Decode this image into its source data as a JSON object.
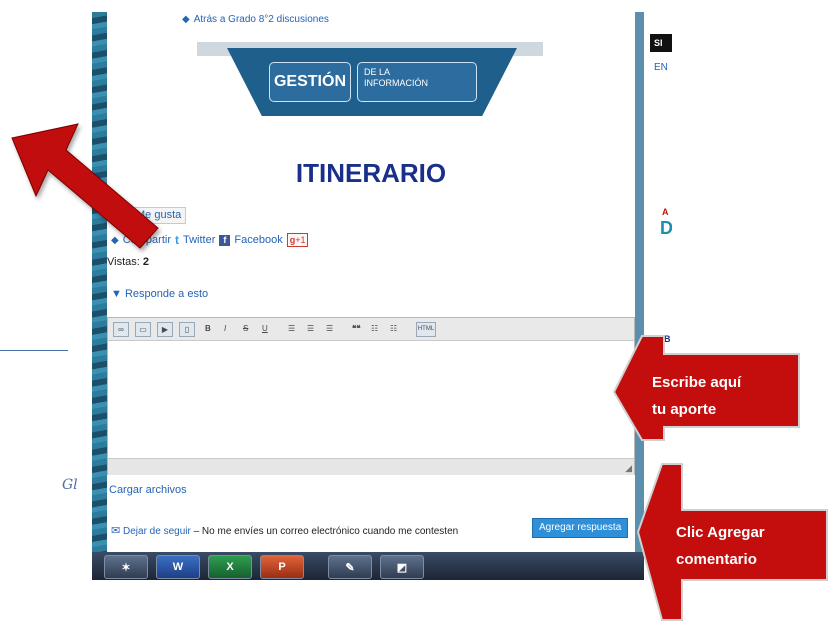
{
  "page": {
    "back_link": "Atrás a Grado 8°2 discusiones",
    "banner_main": "GESTIÓN",
    "banner_sub_line1": "DE LA",
    "banner_sub_line2": "INFORMACIÓN",
    "title": "ITINERARIO",
    "like_label": "Me gusta",
    "share_label": "Compartir",
    "twitter_label": "Twitter",
    "facebook_label": "Facebook",
    "gplus_label": "+1",
    "views_label": "Vistas:",
    "views_count": "2",
    "reply_toggle": "▼ Responde a esto",
    "upload_label": "Cargar archivos",
    "unfollow_link": "Dejar de seguir",
    "unfollow_text": " – No me envíes un correo electrónico cuando me contesten",
    "submit_label": "Agregar respuesta"
  },
  "toolbar": {
    "html_label": "HTML",
    "bold": "B",
    "italic": "I",
    "strike": "S",
    "underline": "U",
    "quote": "❝❝"
  },
  "sidebar": {
    "header": "SI",
    "en_label": "EN",
    "char_a": "A",
    "char_d": "D",
    "char_b": "B"
  },
  "annotations": {
    "stray_text": "Gl",
    "callout1_line1": "Escribe aquí",
    "callout1_line2": "tu aporte",
    "callout2_line1": "Clic Agregar",
    "callout2_line2": "comentario"
  },
  "taskbar": {
    "word_label": "W",
    "excel_label": "X",
    "ppt_label": "P"
  },
  "colors": {
    "accent_blue": "#1f5f8b",
    "link_blue": "#2464b4",
    "title_blue": "#1a2f8a",
    "callout_red": "#c40d0d",
    "arrow_red": "#c10a0a",
    "submit_blue": "#2f8fd8"
  }
}
